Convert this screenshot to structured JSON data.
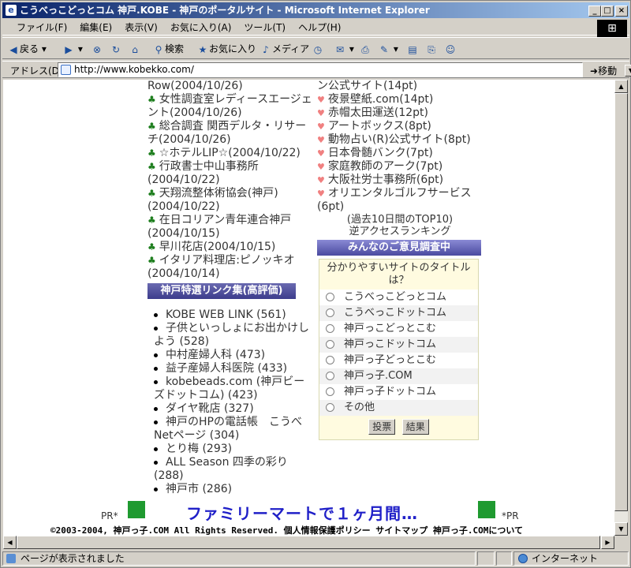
{
  "window": {
    "title": "こうべっこどっとコム 神戸.KOBE - 神戸のポータルサイト - Microsoft Internet Explorer",
    "min": "_",
    "max": "□",
    "close": "×"
  },
  "menu": [
    "ファイル(F)",
    "編集(E)",
    "表示(V)",
    "お気に入り(A)",
    "ツール(T)",
    "ヘルプ(H)"
  ],
  "toolbar": {
    "back": "戻る",
    "search": "検索",
    "favorites": "お気に入り",
    "media": "メディア"
  },
  "address": {
    "label": "アドレス(D)",
    "url": "http://www.kobekko.com/",
    "go": "移動"
  },
  "news": [
    "Row(2004/10/26)",
    "女性調査室レディースエージェント(2004/10/26)",
    "総合調査 関西デルタ・リサーチ(2004/10/26)",
    "☆ホテルLIP☆(2004/10/22)",
    "行政書士中山事務所(2004/10/22)",
    "天翔流整体術協会(神戸)(2004/10/22)",
    "在日コリアン青年連合神戸(2004/10/15)",
    "早川花店(2004/10/15)",
    "イタリア料理店:ピノッキオ(2004/10/14)"
  ],
  "links_header": "神戸特選リンク集(高評価)",
  "links": [
    "KOBE WEB LINK (561)",
    "子供といっしょにお出かけしよう (528)",
    "中村産婦人科 (473)",
    "益子産婦人科医院 (433)",
    "kobebeads.com (神戸ビーズドットコム) (423)",
    "ダイヤ靴店 (327)",
    "神戸のHPの電話帳　こうべNetページ (304)",
    "とり梅 (293)",
    "ALL Season 四季の彩り (288)",
    "神戸市 (286)"
  ],
  "ranking": {
    "first": "ン公式サイト(14pt)",
    "items": [
      "夜景壁紙.com(14pt)",
      "赤帽太田運送(12pt)",
      "アートボックス(8pt)",
      "動物占い(R)公式サイト(8pt)",
      "日本骨髄バンク(7pt)",
      "家庭教師のアーク(7pt)",
      "大阪社労士事務所(6pt)",
      "オリエンタルゴルフサービス(6pt)"
    ],
    "caption1": "(過去10日間のTOP10)",
    "caption2": "逆アクセスランキング"
  },
  "survey": {
    "header": "みんなのご意見調査中",
    "question": "分かりやすいサイトのタイトルは？",
    "options": [
      "こうべっこどっとコム",
      "こうべっこドットコム",
      "神戸っこどっとこむ",
      "神戸っこドットコム",
      "神戸っ子どっとこむ",
      "神戸っ子.COM",
      "神戸っ子ドットコム",
      "その他"
    ],
    "vote": "投票",
    "results": "結果"
  },
  "banner": {
    "pr_left": "PR*",
    "text": "ファミリーマートで１ヶ月間…",
    "pr_right": "*PR"
  },
  "footer": "©2003-2004, 神戸っ子.COM  All Rights Reserved.  個人情報保護ポリシー  サイトマップ  神戸っ子.COMについて",
  "status": {
    "text": "ページが表示されました",
    "zone": "インターネット"
  }
}
